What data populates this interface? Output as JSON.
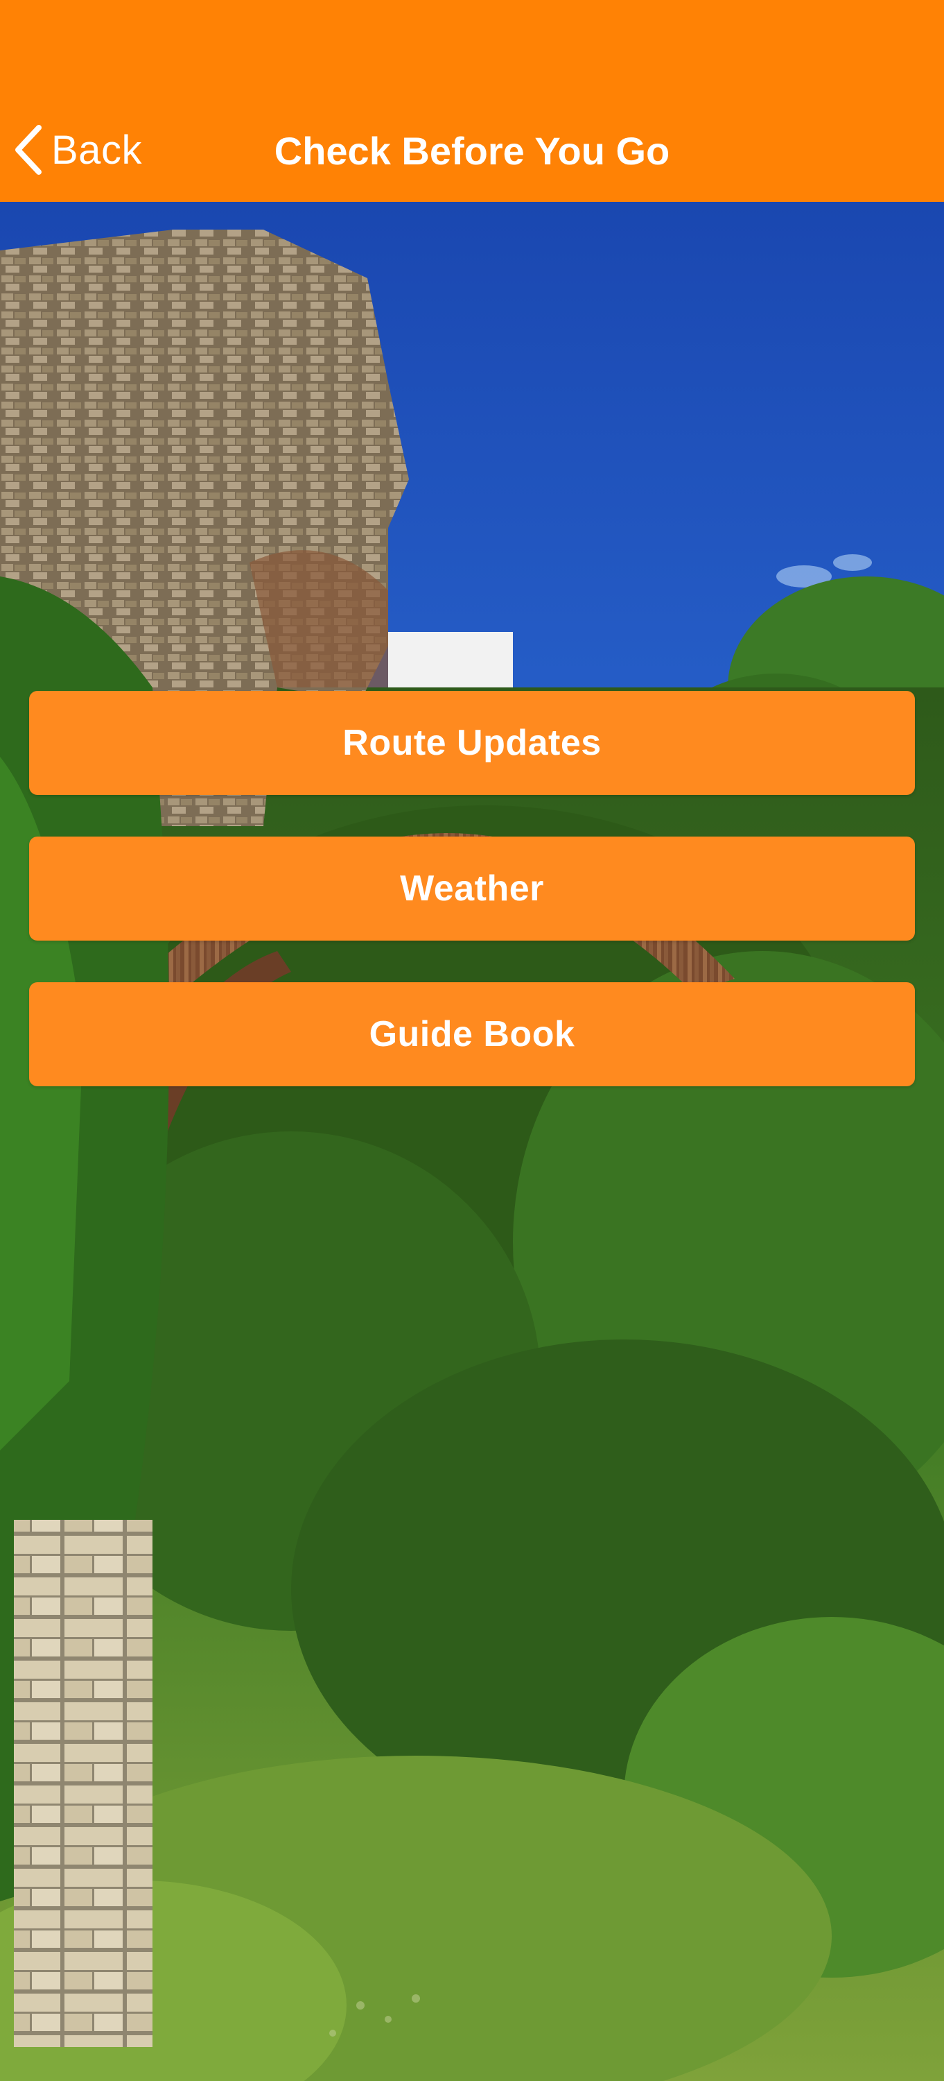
{
  "header": {
    "back_label": "Back",
    "back_icon": "chevron-left-icon",
    "title": "Check Before You Go",
    "background_color": "#FF8205"
  },
  "menu": {
    "items": [
      {
        "label": "Route Updates"
      },
      {
        "label": "Weather"
      },
      {
        "label": "Guide Book"
      }
    ],
    "button_color": "#FF8A1F",
    "text_color": "#FFFFFF"
  },
  "background": {
    "sky_color": "#1E4FB8",
    "foliage_color": "#3E7A22",
    "stone_color": "#8C7A5E"
  }
}
